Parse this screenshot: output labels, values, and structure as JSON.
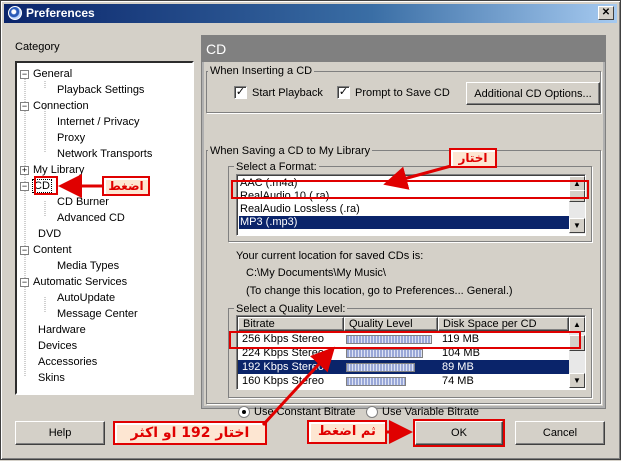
{
  "window": {
    "title": "Preferences",
    "close_glyph": "✕"
  },
  "category_label": "Category",
  "tree": [
    {
      "label": "General",
      "exp": "−"
    },
    {
      "label": "Playback Settings"
    },
    {
      "label": "Connection",
      "exp": "−"
    },
    {
      "label": "Internet / Privacy"
    },
    {
      "label": "Proxy"
    },
    {
      "label": "Network Transports"
    },
    {
      "label": "My Library",
      "exp": "+"
    },
    {
      "label": "CD",
      "exp": "−"
    },
    {
      "label": "CD Burner"
    },
    {
      "label": "Advanced CD"
    },
    {
      "label": "DVD"
    },
    {
      "label": "Content",
      "exp": "−"
    },
    {
      "label": "Media Types"
    },
    {
      "label": "Automatic Services",
      "exp": "−"
    },
    {
      "label": "AutoUpdate"
    },
    {
      "label": "Message Center"
    },
    {
      "label": "Hardware"
    },
    {
      "label": "Devices"
    },
    {
      "label": "Accessories"
    },
    {
      "label": "Skins"
    }
  ],
  "panel": {
    "title": "CD",
    "inserting": {
      "title": "When Inserting a CD",
      "start_playback": "Start Playback",
      "prompt_to_save": "Prompt to Save CD",
      "additional_button": "Additional CD Options...",
      "check_glyph": "✓"
    },
    "saving": {
      "title": "When Saving a CD to My Library",
      "format_title": "Select a Format:",
      "formats": [
        "AAC (.m4a)",
        "RealAudio 10 (.ra)",
        "RealAudio Lossless (.ra)",
        "MP3 (.mp3)"
      ],
      "location_line1": "Your current location for saved CDs is:",
      "location_path": "C:\\My Documents\\My Music\\",
      "location_line3": "(To change this location, go to Preferences... General.)",
      "quality_title": "Select a Quality Level:",
      "columns": [
        "Bitrate",
        "Quality Level",
        "Disk Space per CD"
      ],
      "rows": [
        {
          "bitrate": "256 Kbps Stereo",
          "quality": 1.0,
          "space": "119 MB"
        },
        {
          "bitrate": "224 Kbps Stereo",
          "quality": 0.9,
          "space": "104 MB"
        },
        {
          "bitrate": "192 Kbps Stereo",
          "quality": 0.8,
          "space": "89 MB"
        },
        {
          "bitrate": "160 Kbps Stereo",
          "quality": 0.7,
          "space": "74 MB"
        }
      ],
      "constant_bitrate": "Use Constant Bitrate",
      "variable_bitrate": "Use Variable Bitrate"
    }
  },
  "buttons": {
    "help": "Help",
    "ok": "OK",
    "cancel": "Cancel"
  },
  "annotations": {
    "click": "اضغط",
    "choose": "اختار",
    "choose192": "اختار 192 او اكثر",
    "then_click": "ثم اضغط",
    "color": "#e00000"
  }
}
